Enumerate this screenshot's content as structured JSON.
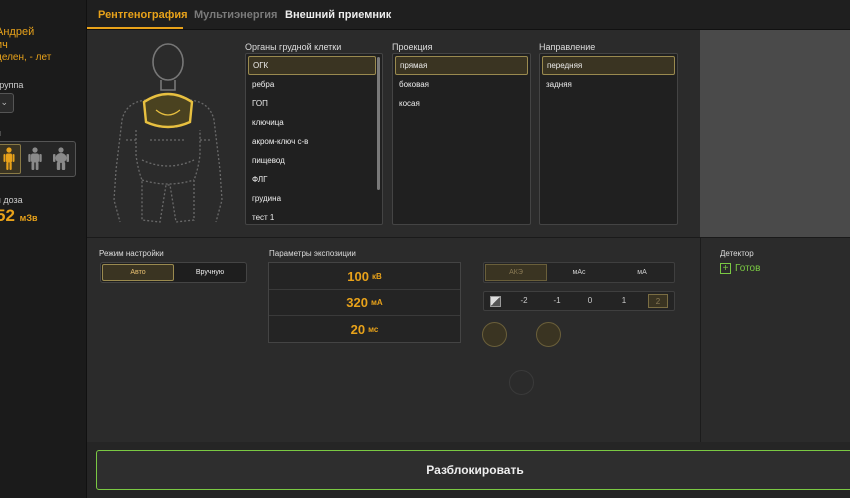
{
  "patient": {
    "name_line1": "Андрей",
    "name_line2": "ич",
    "details": "делен, - лет",
    "group_label": "группа",
    "build_label": "я",
    "build_options": [
      {
        "icon": "thin-person-icon",
        "selected": true
      },
      {
        "icon": "medium-person-icon",
        "selected": false
      },
      {
        "icon": "heavy-person-icon",
        "selected": false
      }
    ],
    "dose_label": "я доза",
    "dose_value": "52",
    "dose_unit": "мЗв"
  },
  "tabs": [
    {
      "label": "Рентгенография",
      "state": "active"
    },
    {
      "label": "Мультиэнергия",
      "state": "disabled"
    },
    {
      "label": "Внешний приемник",
      "state": "normal"
    }
  ],
  "organs": {
    "title": "Органы грудной клетки",
    "items": [
      "ОГК",
      "ребра",
      "ГОП",
      "ключица",
      "акром-ключ с-в",
      "пищевод",
      "ФЛГ",
      "грудина",
      "тест 1"
    ],
    "selected_index": 0
  },
  "projection": {
    "title": "Проекция",
    "items": [
      "прямая",
      "боковая",
      "косая"
    ],
    "selected_index": 0
  },
  "direction": {
    "title": "Направление",
    "items": [
      "передняя",
      "задняя"
    ],
    "selected_index": 0
  },
  "mode": {
    "title": "Режим настройки",
    "options": [
      "Авто",
      "Вручную"
    ],
    "selected_index": 0
  },
  "exposure": {
    "title": "Параметры экспозиции",
    "kv": "100",
    "kv_unit": "кВ",
    "ma": "320",
    "ma_unit": "мА",
    "ms": "20",
    "ms_unit": "мс"
  },
  "units": {
    "options": [
      "АКЭ",
      "мАс",
      "мА"
    ],
    "selected_index": 0
  },
  "aec": {
    "values": [
      "-2",
      "-1",
      "0",
      "1",
      "2"
    ],
    "selected_index": 4
  },
  "detector": {
    "label": "Детектор",
    "status": "Готов",
    "status_color": "#7ac943"
  },
  "unlock_label": "Разблокировать",
  "colors": {
    "accent": "#e8a21a",
    "ready": "#7ac943"
  }
}
